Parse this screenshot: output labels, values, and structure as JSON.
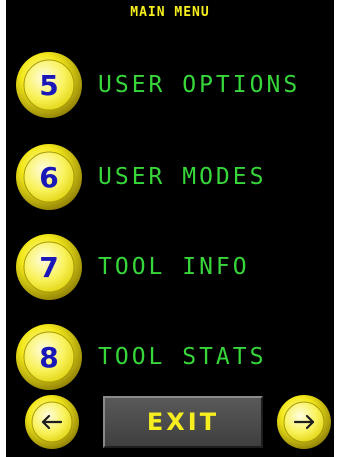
{
  "title": "MAIN MENU",
  "menu": [
    {
      "number": "5",
      "label": "USER OPTIONS"
    },
    {
      "number": "6",
      "label": "USER MODES"
    },
    {
      "number": "7",
      "label": "TOOL INFO"
    },
    {
      "number": "8",
      "label": "TOOL STATS"
    }
  ],
  "footer": {
    "exit_label": "EXIT",
    "back_icon": "arrow-left-icon",
    "forward_icon": "arrow-right-icon"
  },
  "colors": {
    "background": "#000000",
    "title": "#f6ee1e",
    "menu_text": "#37d63a",
    "number_text": "#1a17b8",
    "button_yellow": "#f6ee1e",
    "exit_button": "#4a4a4a"
  }
}
